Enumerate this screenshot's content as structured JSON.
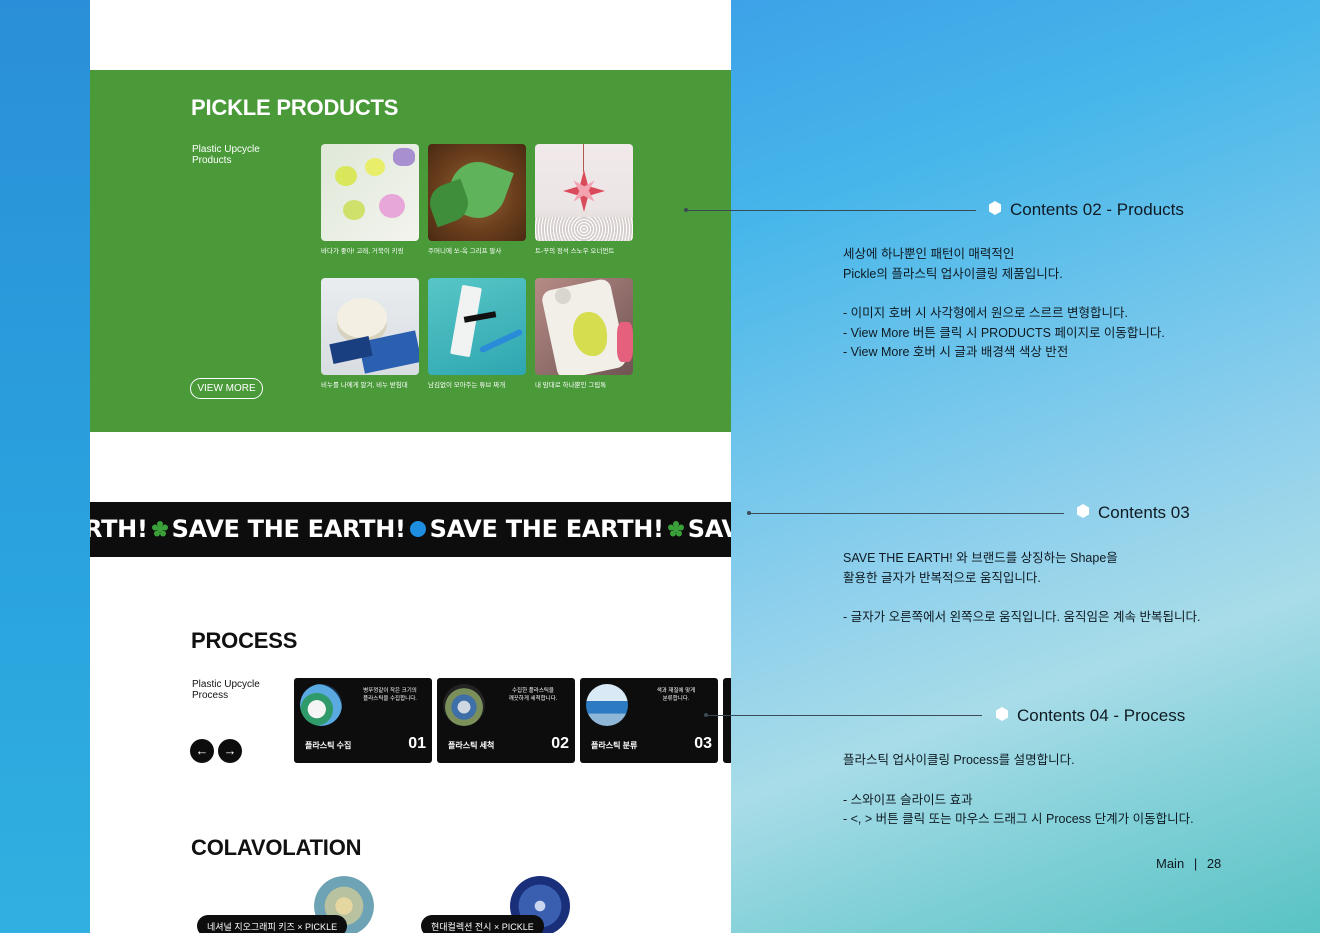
{
  "products": {
    "title": "PICKLE PRODUCTS",
    "subtitle": "Plastic Upcycle\nProducts",
    "view_more": "VIEW MORE",
    "items": [
      {
        "caption": "바다가 좋아! 고래, 거북이 키링"
      },
      {
        "caption": "주머니에 쏘-옥 그리프 팔사"
      },
      {
        "caption": "트-꾸의 정석 스노우 오너먼트"
      },
      {
        "caption": "비누를 나에게 말겨, 비누 받침대"
      },
      {
        "caption": "남김없이 모아주는 튜브 짜개"
      },
      {
        "caption": "내 맘대로 하나뿐인 그립톡"
      }
    ]
  },
  "marquee": {
    "fragments": [
      "RTH!",
      "SAVE THE EARTH!",
      "SAVE THE EARTH!",
      "SAVE T"
    ]
  },
  "process": {
    "title": "PROCESS",
    "subtitle": "Plastic Upcycle\nProcess",
    "prev_label": "←",
    "next_label": "→",
    "cards": [
      {
        "name": "플라스틱 수집",
        "num": "01",
        "desc": "병뚜껑같이 작은 크기의\n플라스틱을 수집합니다."
      },
      {
        "name": "플라스틱 세척",
        "num": "02",
        "desc": "수집한 플라스틱을\n깨끗하게 세척합니다."
      },
      {
        "name": "플라스틱 분류",
        "num": "03",
        "desc": "색과 재질에 맞게\n분류합니다."
      }
    ]
  },
  "colab": {
    "title": "COLAVOLATION",
    "items": [
      {
        "label": "네셔널 지오그래피 키즈 × PICKLE"
      },
      {
        "label": "현대컬렉션 전시 × PICKLE"
      }
    ]
  },
  "annotations": [
    {
      "title": "Contents 02 - Products",
      "lines": [
        "세상에 하나뿐인 패턴이 매력적인",
        "Pickle의 플라스틱 업사이클링 제품입니다.",
        "",
        "- 이미지 호버 시 사각형에서 원으로 스르르 변형합니다.",
        "- View More 버튼 클릭 시 PRODUCTS  페이지로 이동합니다.",
        "- View More 호버 시  글과 배경색 색상 반전"
      ]
    },
    {
      "title": "Contents 03",
      "lines": [
        "SAVE THE  EARTH! 와 브랜드를 상징하는 Shape을",
        "활용한 글자가 반복적으로 움직입니다.",
        "",
        "- 글자가 오른쪽에서 왼쪽으로 움직입니다. 움직임은 계속 반복됩니다."
      ]
    },
    {
      "title": "Contents 04 - Process",
      "lines": [
        "플라스틱 업사이클링 Process를 설명합니다.",
        "",
        "- 스와이프 슬라이드 효과",
        "- <, > 버튼 클릭 또는 마우스 드래그 시 Process 단계가 이동합니다."
      ]
    }
  ],
  "footer": {
    "section": "Main",
    "separator": "|",
    "page": "28"
  },
  "colors": {
    "green": "#4a9a3a",
    "black": "#0d0d0d",
    "shape_green": "#3aa13a",
    "shape_blue": "#1e8fe0"
  }
}
